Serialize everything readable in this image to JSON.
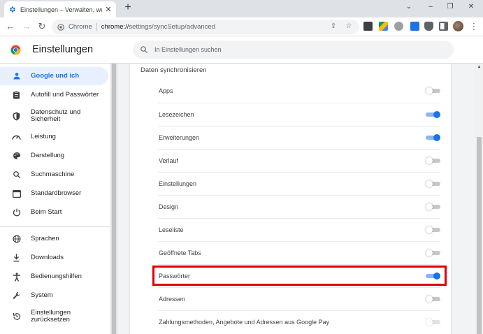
{
  "browser": {
    "tab": {
      "title": "Einstellungen – Verwalten, welch",
      "favicon": "gear-icon"
    },
    "new_tab": "+",
    "window_controls": {
      "minimize": "–",
      "restore": "❐",
      "close": "✕",
      "menu": "⌄"
    },
    "omnibox": {
      "site_chip": "Chrome",
      "url_host": "chrome://",
      "url_path": "settings/syncSetup/advanced"
    }
  },
  "header": {
    "title": "Einstellungen",
    "search": {
      "placeholder": "In Einstellungen suchen"
    }
  },
  "sidebar": {
    "items": [
      {
        "label": "Google und ich",
        "icon": "person-icon"
      },
      {
        "label": "Autofill und Passwörter",
        "icon": "clipboard-icon"
      },
      {
        "label": "Datenschutz und Sicherheit",
        "icon": "shield-icon"
      },
      {
        "label": "Leistung",
        "icon": "speedometer-icon"
      },
      {
        "label": "Darstellung",
        "icon": "palette-icon"
      },
      {
        "label": "Suchmaschine",
        "icon": "search-icon"
      },
      {
        "label": "Standardbrowser",
        "icon": "browser-window-icon"
      },
      {
        "label": "Beim Start",
        "icon": "power-icon"
      },
      {
        "label": "Sprachen",
        "icon": "globe-icon"
      },
      {
        "label": "Downloads",
        "icon": "download-icon"
      },
      {
        "label": "Bedienungshilfen",
        "icon": "accessibility-icon"
      },
      {
        "label": "System",
        "icon": "wrench-icon"
      },
      {
        "label": "Einstellungen zurücksetzen",
        "icon": "reset-icon"
      }
    ]
  },
  "main": {
    "section_title": "Daten synchronisieren",
    "rows": [
      {
        "label": "Apps",
        "enabled": false
      },
      {
        "label": "Lesezeichen",
        "enabled": true
      },
      {
        "label": "Erweiterungen",
        "enabled": true
      },
      {
        "label": "Verlauf",
        "enabled": false
      },
      {
        "label": "Einstellungen",
        "enabled": false
      },
      {
        "label": "Design",
        "enabled": false
      },
      {
        "label": "Leseliste",
        "enabled": false
      },
      {
        "label": "Geöffnete Tabs",
        "enabled": false
      },
      {
        "label": "Passwörter",
        "enabled": true
      },
      {
        "label": "Adressen",
        "enabled": false
      },
      {
        "label": "Zahlungsmethoden, Angebote und Adressen aus Google Pay",
        "enabled": false
      }
    ]
  },
  "colors": {
    "accent": "#1a73e8",
    "highlight": "#e00000",
    "active_bg": "#e8f0fe"
  }
}
